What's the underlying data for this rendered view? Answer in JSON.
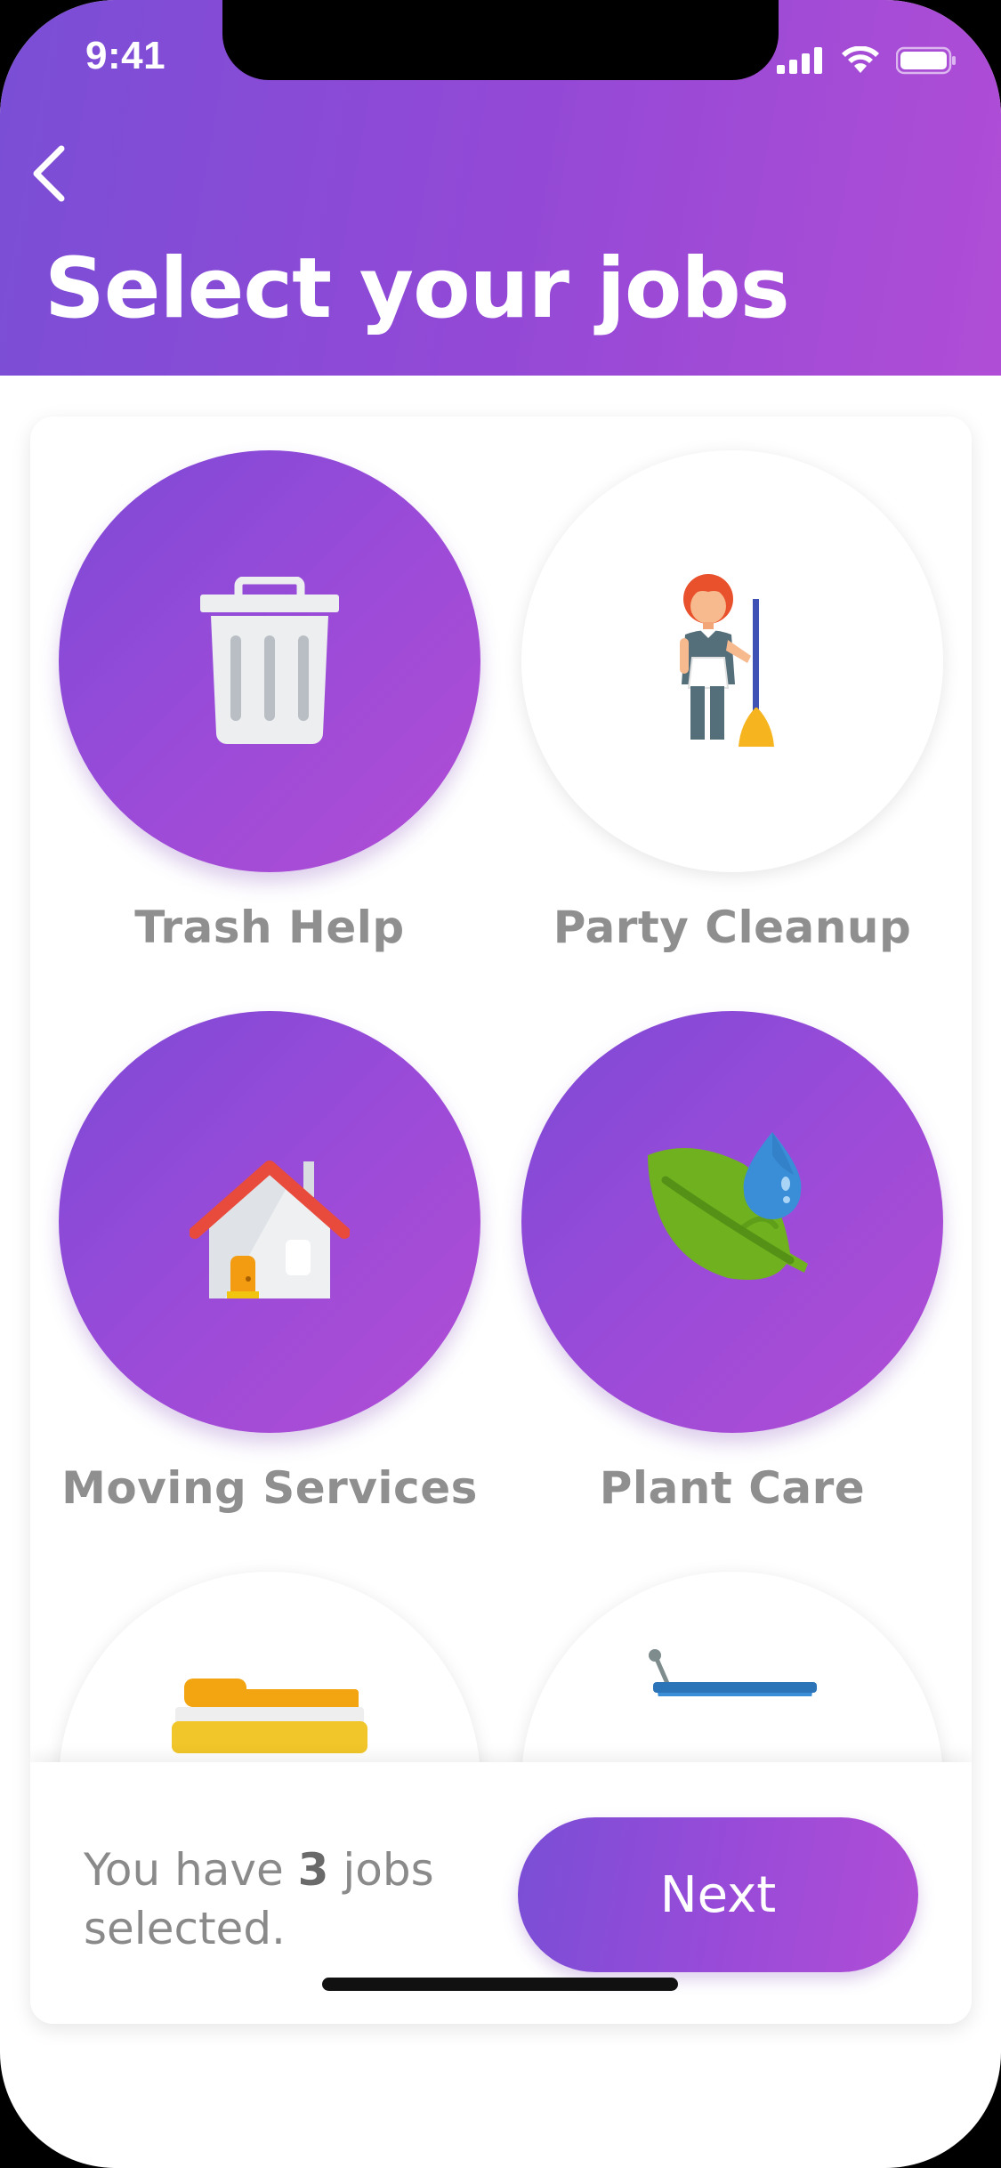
{
  "status_bar": {
    "time": "9:41",
    "signal_icon": "cellular-signal-icon",
    "wifi_icon": "wifi-icon",
    "battery_icon": "battery-icon"
  },
  "header": {
    "back_icon": "chevron-left-icon",
    "title": "Select your jobs"
  },
  "jobs": [
    {
      "label": "Trash Help",
      "icon": "trash-can-icon",
      "selected": true
    },
    {
      "label": "Party Cleanup",
      "icon": "maid-with-broom-icon",
      "selected": false
    },
    {
      "label": "Moving Services",
      "icon": "house-icon",
      "selected": true
    },
    {
      "label": "Plant Care",
      "icon": "leaf-with-water-drop-icon",
      "selected": true
    },
    {
      "label": "",
      "icon": "bed-icon",
      "selected": false
    },
    {
      "label": "",
      "icon": "shopping-basket-icon",
      "selected": false
    }
  ],
  "footer": {
    "prefix": "You have ",
    "count": "3",
    "suffix": " jobs selected.",
    "next_label": "Next"
  },
  "colors": {
    "accent_start": "#7a4ed6",
    "accent_end": "#b04dd6",
    "label_gray": "#8f8f8f"
  }
}
